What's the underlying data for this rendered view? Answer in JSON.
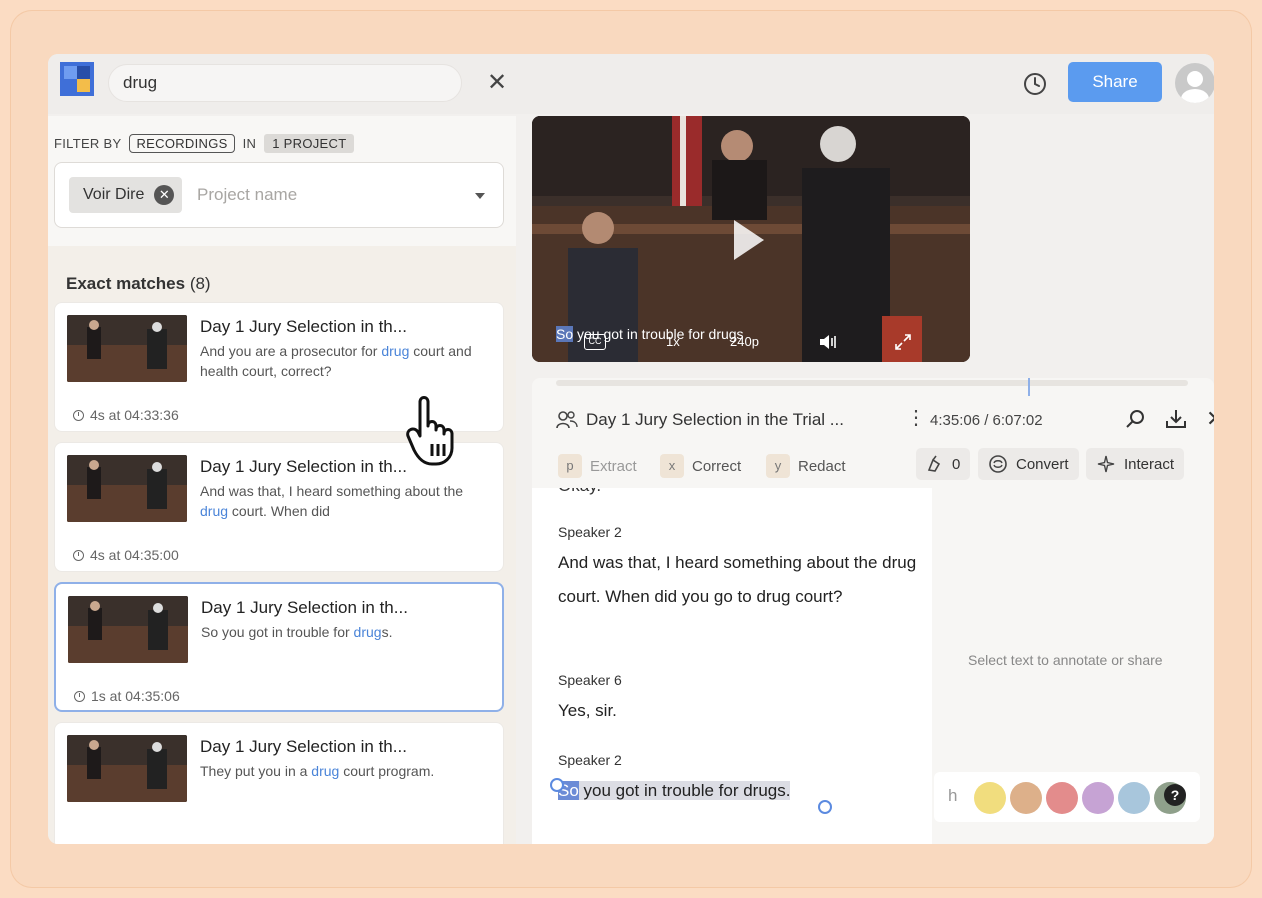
{
  "search": {
    "value": "drug"
  },
  "header": {
    "share_label": "Share"
  },
  "filter": {
    "prefix": "FILTER BY",
    "type_chip": "RECORDINGS",
    "in_label": "IN",
    "project_chip": "1 PROJECT",
    "project_tag": "Voir Dire",
    "project_placeholder": "Project name"
  },
  "results": {
    "title": "Exact matches",
    "count": "(8)",
    "items": [
      {
        "title": "Day 1 Jury Selection in th...",
        "pre": "And you are a prosecutor for ",
        "hl": "drug",
        "post": " court and health court, correct?",
        "time": "4s at 04:33:36"
      },
      {
        "title": "Day 1 Jury Selection in th...",
        "pre": "And was that, I heard something about the ",
        "hl": "drug",
        "post": " court. When did",
        "time": "4s at 04:35:00"
      },
      {
        "title": "Day 1 Jury Selection in th...",
        "pre": "So you got in trouble for ",
        "hl": "drug",
        "post": "s.",
        "time": "1s at 04:35:06"
      },
      {
        "title": "Day 1 Jury Selection in th...",
        "pre": "They put you in a ",
        "hl": "drug",
        "post": " court program.",
        "time": ""
      }
    ]
  },
  "video": {
    "subtitle_sel": "So",
    "subtitle_rest": " you got in trouble for drugs",
    "speed": "1x",
    "quality": "240p"
  },
  "transcript": {
    "title": "Day 1 Jury Selection in the Trial ...",
    "time": "4:35:06 / 6:07:02",
    "tools": {
      "extract_key": "p",
      "extract": "Extract",
      "correct_key": "x",
      "correct": "Correct",
      "redact_key": "y",
      "redact": "Redact",
      "count": "0",
      "convert": "Convert",
      "interact": "Interact"
    },
    "cut_text": "Okay.",
    "blocks": [
      {
        "speaker": "Speaker 2",
        "text": "And was that, I heard something about the drug court. When did you go to drug court?"
      },
      {
        "speaker": "Speaker 6",
        "text": "Yes, sir."
      },
      {
        "speaker": "Speaker 2",
        "sel_first": "So",
        "sel_rest": " you got in trouble for drugs."
      }
    ],
    "side_hint": "Select text to annotate or share",
    "palette_label": "h",
    "colors": [
      "#f1dd7e",
      "#ddb08a",
      "#e38c8c",
      "#c6a3d4",
      "#a8c6dc",
      "#8fa08b"
    ]
  }
}
